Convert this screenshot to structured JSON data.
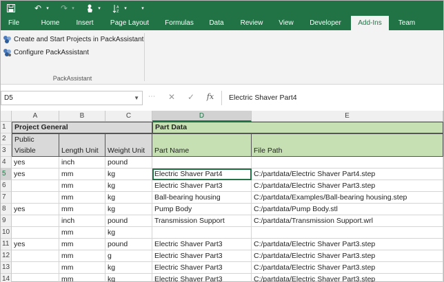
{
  "tabs": [
    {
      "label": "File"
    },
    {
      "label": "Home"
    },
    {
      "label": "Insert"
    },
    {
      "label": "Page Layout"
    },
    {
      "label": "Formulas"
    },
    {
      "label": "Data"
    },
    {
      "label": "Review"
    },
    {
      "label": "View"
    },
    {
      "label": "Developer"
    },
    {
      "label": "Add-Ins",
      "active": true
    },
    {
      "label": "Team"
    }
  ],
  "ribbon": {
    "commands": [
      {
        "label": "Create and Start Projects in PackAssistant",
        "icon": "packassistant-create-icon"
      },
      {
        "label": "Configure PackAssistant",
        "icon": "packassistant-configure-icon"
      }
    ],
    "group_label": "PackAssistant"
  },
  "formula_bar": {
    "name_box": "D5",
    "cancel": "✕",
    "enter": "✓",
    "fx": "fx",
    "content": "Electric Shaver Part4"
  },
  "columns": [
    "A",
    "B",
    "C",
    "D",
    "E"
  ],
  "rows": [
    {
      "num": "1",
      "A": "Project General",
      "D": "Part Data"
    },
    {
      "num": "2",
      "A": "Public"
    },
    {
      "num": "3",
      "A": "Visible",
      "B": "Length Unit",
      "C": "Weight Unit",
      "D": "Part Name",
      "E": "File Path"
    },
    {
      "num": "4",
      "A": "yes",
      "B": "inch",
      "C": "pound",
      "D": "",
      "E": ""
    },
    {
      "num": "5",
      "A": "yes",
      "B": "mm",
      "C": "kg",
      "D": "Electric Shaver Part4",
      "E": "C:/partdata/Electric Shaver Part4.step"
    },
    {
      "num": "6",
      "A": "",
      "B": "mm",
      "C": "kg",
      "D": "Electric Shaver Part3",
      "E": "C:/partdata/Electric Shaver Part3.step"
    },
    {
      "num": "7",
      "A": "",
      "B": "mm",
      "C": "kg",
      "D": "Ball-bearing housing",
      "E": "C:/partdata/Examples/Ball-bearing housing.step"
    },
    {
      "num": "8",
      "A": "yes",
      "B": "mm",
      "C": "kg",
      "D": "Pump Body",
      "E": "C:/partdata/Pump Body.stl"
    },
    {
      "num": "9",
      "A": "",
      "B": "inch",
      "C": "pound",
      "D": "Transmission Support",
      "E": "C:/partdata/Transmission Support.wrl"
    },
    {
      "num": "10",
      "A": "",
      "B": "mm",
      "C": "kg",
      "D": "",
      "E": ""
    },
    {
      "num": "11",
      "A": "yes",
      "B": "mm",
      "C": "pound",
      "D": "Electric Shaver Part3",
      "E": "C:/partdata/Electric Shaver Part3.step"
    },
    {
      "num": "12",
      "A": "",
      "B": "mm",
      "C": "g",
      "D": "Electric Shaver Part3",
      "E": "C:/partdata/Electric Shaver Part3.step"
    },
    {
      "num": "13",
      "A": "",
      "B": "mm",
      "C": "kg",
      "D": "Electric Shaver Part3",
      "E": "C:/partdata/Electric Shaver Part3.step"
    },
    {
      "num": "14",
      "A": "",
      "B": "mm",
      "C": "kg",
      "D": "Electric Shaver Part3",
      "E": "C:/partdata/Electric Shaver Part3.step"
    }
  ],
  "colors": {
    "accent": "#217346",
    "header_gray": "#d9d9d9",
    "header_green": "#c6e0b4"
  }
}
